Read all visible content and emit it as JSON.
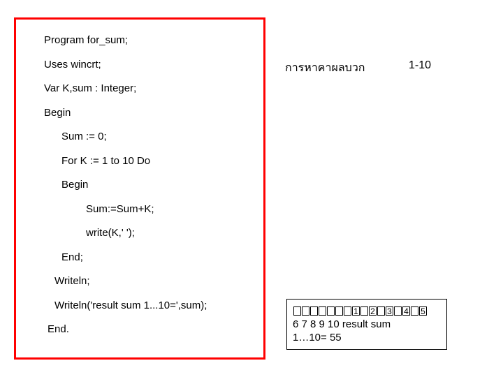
{
  "code": {
    "l1": "Program for_sum;",
    "l2": "Uses wincrt;",
    "l3": "Var   K,sum : Integer;",
    "l4": "Begin",
    "l5": "Sum := 0;",
    "l6": "For K := 1 to 10 Do",
    "l7": "Begin",
    "l8": "Sum:=Sum+K;",
    "l9": " write(K,'  ');",
    "l10": "End;",
    "l11": "Writeln;",
    "l12": "Writeln('result sum 1...10=',sum);",
    "l13": "End."
  },
  "heading": {
    "text": "การหาคาผลบวก",
    "range": "1-10"
  },
  "output": {
    "n1": "1",
    "n2": "2",
    "n3": "3",
    "n4": "4",
    "n5": "5",
    "line2": "6  7  8  9  10 result sum",
    "line3": "1…10= 55"
  }
}
